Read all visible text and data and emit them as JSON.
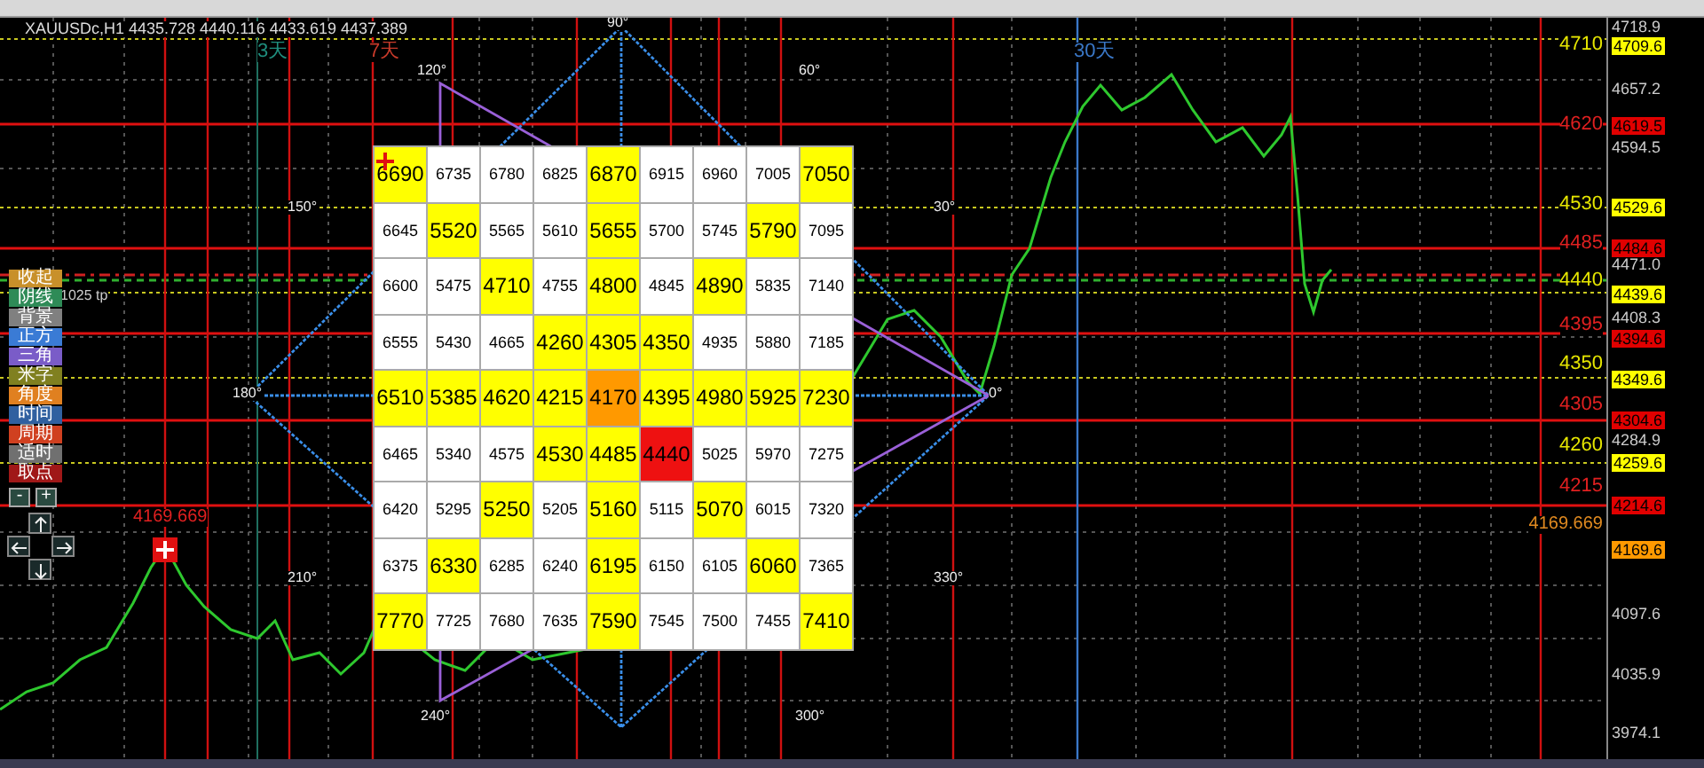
{
  "chart": {
    "symbol_info": "XAUUSDc,H1  4435.728 4440.116 4433.619 4437.389",
    "period_labels": [
      {
        "text": "3天",
        "color": "#1f8f7f"
      },
      {
        "text": "7天",
        "color": "#c83a2a"
      },
      {
        "text": "30天",
        "color": "#3a78c8"
      }
    ],
    "angle_labels": [
      "90°",
      "120°",
      "60°",
      "150°",
      "30°",
      "180°",
      "0°",
      "210°",
      "330°",
      "240°",
      "300°"
    ],
    "grid": {
      "rows": [
        [
          {
            "value": "6690",
            "color": "#ffff00"
          },
          {
            "value": "6735",
            "color": "#ffffff"
          },
          {
            "value": "6780",
            "color": "#ffffff"
          },
          {
            "value": "6825",
            "color": "#ffffff"
          },
          {
            "value": "6870",
            "color": "#ffff00"
          },
          {
            "value": "6915",
            "color": "#ffffff"
          },
          {
            "value": "6960",
            "color": "#ffffff"
          },
          {
            "value": "7005",
            "color": "#ffffff"
          },
          {
            "value": "7050",
            "color": "#ffff00"
          }
        ],
        [
          {
            "value": "6645",
            "color": "#ffffff"
          },
          {
            "value": "5520",
            "color": "#ffff00"
          },
          {
            "value": "5565",
            "color": "#ffffff"
          },
          {
            "value": "5610",
            "color": "#ffffff"
          },
          {
            "value": "5655",
            "color": "#ffff00"
          },
          {
            "value": "5700",
            "color": "#ffffff"
          },
          {
            "value": "5745",
            "color": "#ffffff"
          },
          {
            "value": "5790",
            "color": "#ffff00"
          },
          {
            "value": "7095",
            "color": "#ffffff"
          }
        ],
        [
          {
            "value": "6600",
            "color": "#ffffff"
          },
          {
            "value": "5475",
            "color": "#ffffff"
          },
          {
            "value": "4710",
            "color": "#ffff00"
          },
          {
            "value": "4755",
            "color": "#ffffff"
          },
          {
            "value": "4800",
            "color": "#ffff00"
          },
          {
            "value": "4845",
            "color": "#ffffff"
          },
          {
            "value": "4890",
            "color": "#ffff00"
          },
          {
            "value": "5835",
            "color": "#ffffff"
          },
          {
            "value": "7140",
            "color": "#ffffff"
          }
        ],
        [
          {
            "value": "6555",
            "color": "#ffffff"
          },
          {
            "value": "5430",
            "color": "#ffffff"
          },
          {
            "value": "4665",
            "color": "#ffffff"
          },
          {
            "value": "4260",
            "color": "#ffff00"
          },
          {
            "value": "4305",
            "color": "#ffff00"
          },
          {
            "value": "4350",
            "color": "#ffff00"
          },
          {
            "value": "4935",
            "color": "#ffffff"
          },
          {
            "value": "5880",
            "color": "#ffffff"
          },
          {
            "value": "7185",
            "color": "#ffffff"
          }
        ],
        [
          {
            "value": "6510",
            "color": "#ffff00"
          },
          {
            "value": "5385",
            "color": "#ffff00"
          },
          {
            "value": "4620",
            "color": "#ffff00"
          },
          {
            "value": "4215",
            "color": "#ffff00"
          },
          {
            "value": "4170",
            "color": "#ff9900"
          },
          {
            "value": "4395",
            "color": "#ffff00"
          },
          {
            "value": "4980",
            "color": "#ffff00"
          },
          {
            "value": "5925",
            "color": "#ffff00"
          },
          {
            "value": "7230",
            "color": "#ffff00"
          }
        ],
        [
          {
            "value": "6465",
            "color": "#ffffff"
          },
          {
            "value": "5340",
            "color": "#ffffff"
          },
          {
            "value": "4575",
            "color": "#ffffff"
          },
          {
            "value": "4530",
            "color": "#ffff00"
          },
          {
            "value": "4485",
            "color": "#ffff00"
          },
          {
            "value": "4440",
            "color": "#ee1111"
          },
          {
            "value": "5025",
            "color": "#ffffff"
          },
          {
            "value": "5970",
            "color": "#ffffff"
          },
          {
            "value": "7275",
            "color": "#ffffff"
          }
        ],
        [
          {
            "value": "6420",
            "color": "#ffffff"
          },
          {
            "value": "5295",
            "color": "#ffffff"
          },
          {
            "value": "5250",
            "color": "#ffff00"
          },
          {
            "value": "5205",
            "color": "#ffffff"
          },
          {
            "value": "5160",
            "color": "#ffff00"
          },
          {
            "value": "5115",
            "color": "#ffffff"
          },
          {
            "value": "5070",
            "color": "#ffff00"
          },
          {
            "value": "6015",
            "color": "#ffffff"
          },
          {
            "value": "7320",
            "color": "#ffffff"
          }
        ],
        [
          {
            "value": "6375",
            "color": "#ffffff"
          },
          {
            "value": "6330",
            "color": "#ffff00"
          },
          {
            "value": "6285",
            "color": "#ffffff"
          },
          {
            "value": "6240",
            "color": "#ffffff"
          },
          {
            "value": "6195",
            "color": "#ffff00"
          },
          {
            "value": "6150",
            "color": "#ffffff"
          },
          {
            "value": "6105",
            "color": "#ffffff"
          },
          {
            "value": "6060",
            "color": "#ffff00"
          },
          {
            "value": "7365",
            "color": "#ffffff"
          }
        ],
        [
          {
            "value": "7770",
            "color": "#ffff00"
          },
          {
            "value": "7725",
            "color": "#ffffff"
          },
          {
            "value": "7680",
            "color": "#ffffff"
          },
          {
            "value": "7635",
            "color": "#ffffff"
          },
          {
            "value": "7590",
            "color": "#ffff00"
          },
          {
            "value": "7545",
            "color": "#ffffff"
          },
          {
            "value": "7500",
            "color": "#ffffff"
          },
          {
            "value": "7455",
            "color": "#ffffff"
          },
          {
            "value": "7410",
            "color": "#ffff00"
          }
        ]
      ]
    },
    "side_buttons": [
      {
        "label": "收起",
        "color": "#c8902a"
      },
      {
        "label": "阴线",
        "color": "#2e8b57"
      },
      {
        "label": "背景",
        "color": "#808080"
      },
      {
        "label": "正方",
        "color": "#3a7bd5"
      },
      {
        "label": "三角",
        "color": "#7a5cc8"
      },
      {
        "label": "米字",
        "color": "#808020"
      },
      {
        "label": "角度",
        "color": "#e08020"
      },
      {
        "label": "时间",
        "color": "#3060a0"
      },
      {
        "label": "周期",
        "color": "#d04020"
      },
      {
        "label": "适时",
        "color": "#707070"
      },
      {
        "label": "取点",
        "color": "#a01818"
      }
    ],
    "zoom_buttons": [
      "-",
      "+"
    ],
    "info_line": "1025 tp",
    "marker_label": "4169.669",
    "level_labels": [
      {
        "text": "4710",
        "color": "#e6e600"
      },
      {
        "text": "4620",
        "color": "#e02020"
      },
      {
        "text": "4530",
        "color": "#e6e600"
      },
      {
        "text": "4485",
        "color": "#e02020"
      },
      {
        "text": "4440",
        "color": "#e6e600"
      },
      {
        "text": "4395",
        "color": "#e02020"
      },
      {
        "text": "4350",
        "color": "#e6e600"
      },
      {
        "text": "4305",
        "color": "#e02020"
      },
      {
        "text": "4260",
        "color": "#e6e600"
      },
      {
        "text": "4215",
        "color": "#e02020"
      },
      {
        "text": "4169.669",
        "color": "#e08a20"
      }
    ]
  },
  "price_axis": [
    {
      "text": "4718.9",
      "kind": "plain"
    },
    {
      "text": "4709.6",
      "kind": "tag",
      "color": "#ffff00"
    },
    {
      "text": "4657.2",
      "kind": "plain"
    },
    {
      "text": "4619.5",
      "kind": "tag",
      "color": "#e00000"
    },
    {
      "text": "4594.5",
      "kind": "plain"
    },
    {
      "text": "4529.6",
      "kind": "tag",
      "color": "#ffff00"
    },
    {
      "text": "4484.6",
      "kind": "tag",
      "color": "#e00000"
    },
    {
      "text": "4471.0",
      "kind": "plain"
    },
    {
      "text": "4439.6",
      "kind": "tag",
      "color": "#ffff00"
    },
    {
      "text": "4408.3",
      "kind": "plain"
    },
    {
      "text": "4394.6",
      "kind": "tag",
      "color": "#e00000"
    },
    {
      "text": "4349.6",
      "kind": "tag",
      "color": "#ffff00"
    },
    {
      "text": "4304.6",
      "kind": "tag",
      "color": "#e00000"
    },
    {
      "text": "4284.9",
      "kind": "plain"
    },
    {
      "text": "4259.6",
      "kind": "tag",
      "color": "#ffff00"
    },
    {
      "text": "4214.6",
      "kind": "tag",
      "color": "#e00000"
    },
    {
      "text": "4169.6",
      "kind": "tag",
      "color": "#ff9900"
    },
    {
      "text": "4097.6",
      "kind": "plain"
    },
    {
      "text": "4035.9",
      "kind": "plain"
    },
    {
      "text": "3974.1",
      "kind": "plain"
    }
  ]
}
